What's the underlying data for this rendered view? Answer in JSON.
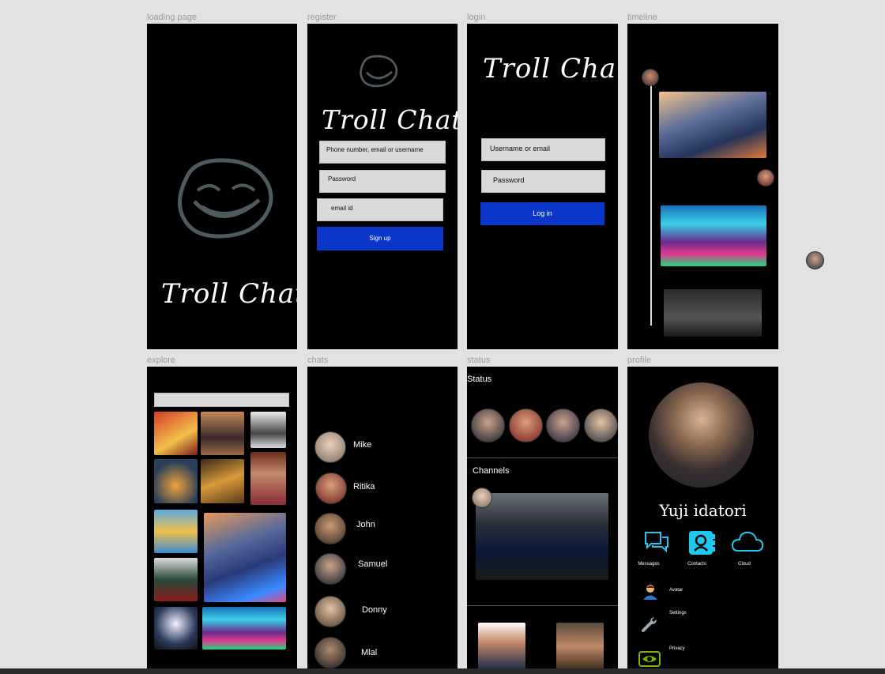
{
  "frames": {
    "loading": "loading page",
    "register": "register",
    "login": "login",
    "timeline": "timeline",
    "explore": "explore",
    "chats": "chats",
    "status": "status",
    "profile": "profile"
  },
  "app_name": "Troll Chat",
  "register": {
    "field1": "Phone number, email or username",
    "field2": "Password",
    "field3": "email id",
    "button": "Sign up"
  },
  "login": {
    "field1": "Username or email",
    "field2": "Password",
    "button": "Log in"
  },
  "chats": [
    "Mike",
    "Ritika",
    "John",
    "Samuel",
    "Donny",
    "Mlal"
  ],
  "status": {
    "title": "Status",
    "channels": "Channels"
  },
  "profile": {
    "name": "Yuji idatori",
    "actions": [
      "Messages",
      "Contacts",
      "Cloud"
    ],
    "menu": [
      "Avatar",
      "Settings",
      "Privacy"
    ]
  },
  "colors": {
    "accent_blue": "#0a36c9",
    "icon_cyan": "#1ec8f0",
    "frame_bg": "#000000",
    "canvas_bg": "#e2e2e2"
  }
}
